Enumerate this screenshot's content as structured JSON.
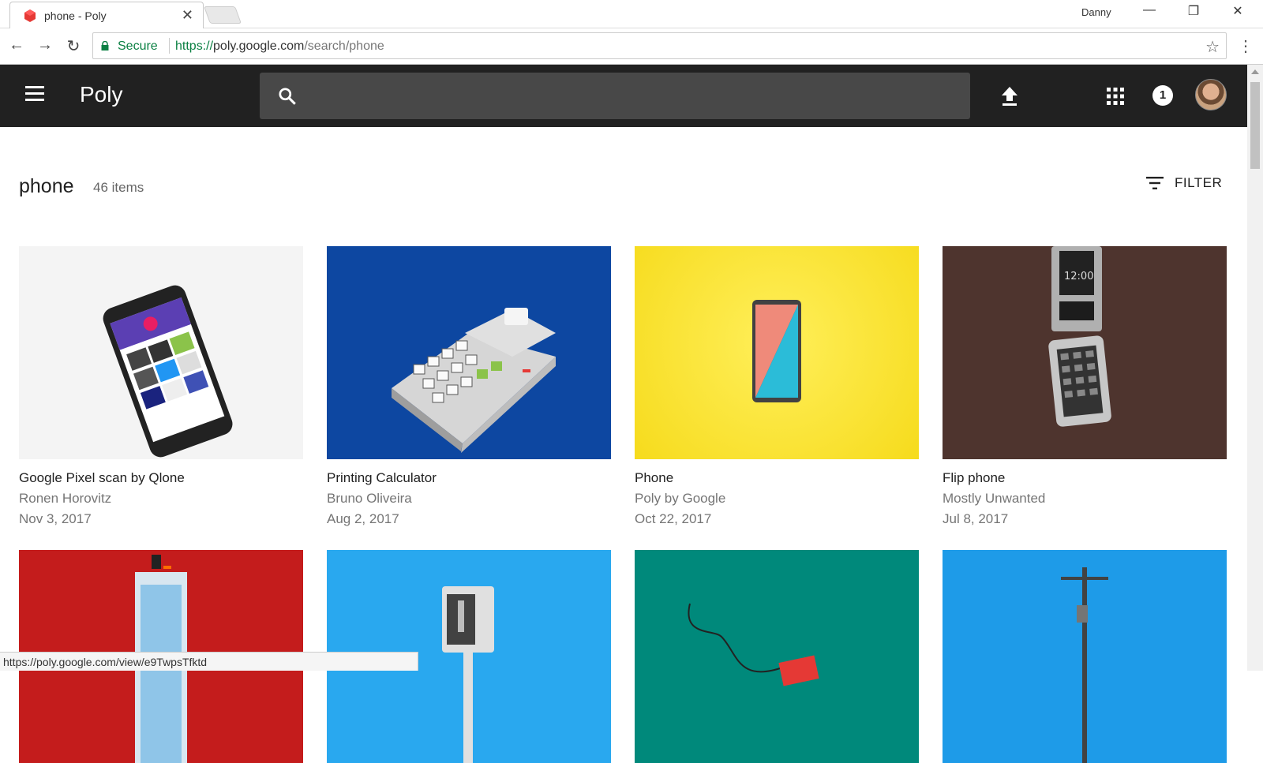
{
  "browser": {
    "tab_title": "phone - Poly",
    "profile": "Danny",
    "secure_label": "Secure",
    "url_scheme": "https://",
    "url_host": "poly.google.com",
    "url_path": "/search/phone",
    "status_url": "https://poly.google.com/view/e9TwpsTfktd"
  },
  "header": {
    "brand": "Poly",
    "search_placeholder": "",
    "notification_count": "1"
  },
  "results": {
    "query": "phone",
    "count": "46 items",
    "filter_label": "FILTER"
  },
  "cards": [
    {
      "title": "Google Pixel scan by Qlone",
      "author": "Ronen Horovitz",
      "date": "Nov 3, 2017",
      "bg": "#f4f4f4"
    },
    {
      "title": "Printing Calculator",
      "author": "Bruno Oliveira",
      "date": "Aug 2, 2017",
      "bg": "#0d47a1"
    },
    {
      "title": "Phone",
      "author": "Poly by Google",
      "date": "Oct 22, 2017",
      "bg": "#fde433"
    },
    {
      "title": "Flip phone",
      "author": "Mostly Unwanted",
      "date": "Jul 8, 2017",
      "bg": "#4e342e"
    },
    {
      "title": "",
      "author": "",
      "date": "",
      "bg": "#c41c1c"
    },
    {
      "title": "",
      "author": "",
      "date": "",
      "bg": "#29a8ef"
    },
    {
      "title": "",
      "author": "",
      "date": "",
      "bg": "#00897b"
    },
    {
      "title": "",
      "author": "",
      "date": "",
      "bg": "#1e9be8"
    }
  ]
}
